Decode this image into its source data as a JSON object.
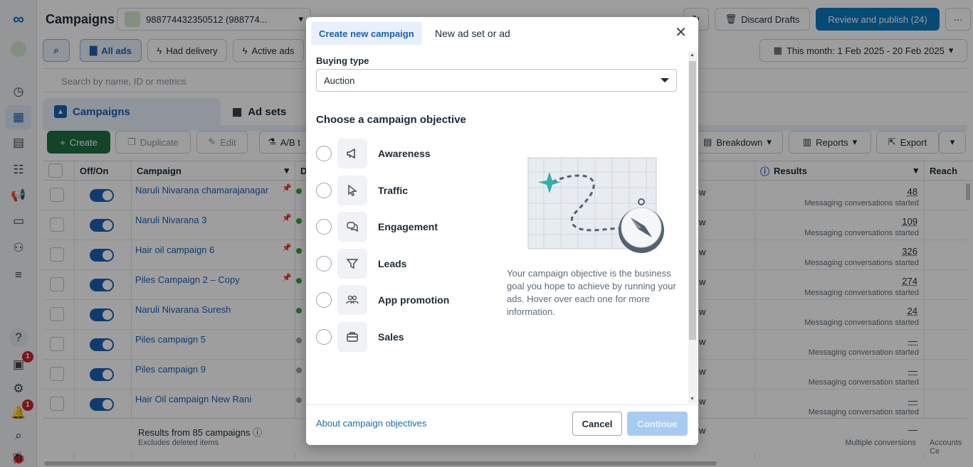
{
  "rail": {
    "badge_inbox": "1",
    "badge_notifications": "1"
  },
  "header": {
    "title": "Campaigns",
    "account": "988774432350512 (988774...",
    "discard_drafts": "Discard Drafts",
    "review_publish": "Review and publish (24)",
    "more": "···"
  },
  "filters": {
    "all_ads": "All ads",
    "had_delivery": "Had delivery",
    "active_ads": "Active ads",
    "date_range": "This month: 1 Feb 2025 - 20 Feb 2025"
  },
  "search": {
    "placeholder": "Search by name, ID or metrics"
  },
  "level_tabs": {
    "campaigns": "Campaigns",
    "ad_sets": "Ad sets"
  },
  "toolbar": {
    "create": "Create",
    "duplicate": "Duplicate",
    "edit": "Edit",
    "ab_test": "A/B t",
    "breakdown": "Breakdown",
    "reports": "Reports",
    "export": "Export"
  },
  "table": {
    "headers": {
      "off_on": "Off/On",
      "campaign": "Campaign",
      "delivery": "D",
      "results": "Results",
      "reach": "Reach"
    },
    "rows": [
      {
        "name": "Naruli Nivarana chamarajanagar",
        "pinned": true,
        "results": "48",
        "result_type": "Messaging conversations started",
        "col": "w"
      },
      {
        "name": "Naruli Nivarana 3",
        "pinned": true,
        "results": "109",
        "result_type": "Messaging conversations started",
        "col": "w"
      },
      {
        "name": "Hair oil campaign 6",
        "pinned": true,
        "results": "326",
        "result_type": "Messaging conversations started",
        "col": "w"
      },
      {
        "name": "Piles Campaign 2 – Copy",
        "pinned": true,
        "results": "274",
        "result_type": "Messaging conversations started",
        "col": "w"
      },
      {
        "name": "Naruli Nivarana Suresh",
        "pinned": false,
        "results": "24",
        "result_type": "Messaging conversations started",
        "col": "w"
      },
      {
        "name": "Piles campaign 5",
        "pinned": false,
        "results": "—",
        "result_type": "Messaging conversation started",
        "col": "w"
      },
      {
        "name": "Piles campaign 9",
        "pinned": false,
        "results": "—",
        "result_type": "Messaging conversation started",
        "col": "w"
      },
      {
        "name": "Hair Oil campaign New Rani",
        "pinned": false,
        "results": "—",
        "result_type": "Messaging conversation started",
        "col": "w"
      }
    ],
    "footer": {
      "summary": "Results from 85 campaigns",
      "note": "Excludes deleted items",
      "results": "—",
      "result_type": "Multiple conversions",
      "reach": "Accounts Ce",
      "col": "w"
    }
  },
  "modal": {
    "tab_create": "Create new campaign",
    "tab_existing": "New ad set or ad",
    "buying_type_label": "Buying type",
    "buying_type_value": "Auction",
    "objective_heading": "Choose a campaign objective",
    "objectives": [
      {
        "label": "Awareness",
        "icon": "megaphone-icon"
      },
      {
        "label": "Traffic",
        "icon": "cursor-icon"
      },
      {
        "label": "Engagement",
        "icon": "chat-bubbles-icon"
      },
      {
        "label": "Leads",
        "icon": "funnel-icon"
      },
      {
        "label": "App promotion",
        "icon": "people-icon"
      },
      {
        "label": "Sales",
        "icon": "briefcase-icon"
      }
    ],
    "description": "Your campaign objective is the business goal you hope to achieve by running your ads. Hover over each one for more information.",
    "about_link": "About campaign objectives",
    "cancel": "Cancel",
    "continue": "Continue"
  },
  "colors": {
    "accent": "#1a5fb4",
    "primary_button": "#0a78be",
    "create_button": "#1e6f3f",
    "continue_disabled": "#a9cbef",
    "map_star": "#2fb3a3"
  }
}
